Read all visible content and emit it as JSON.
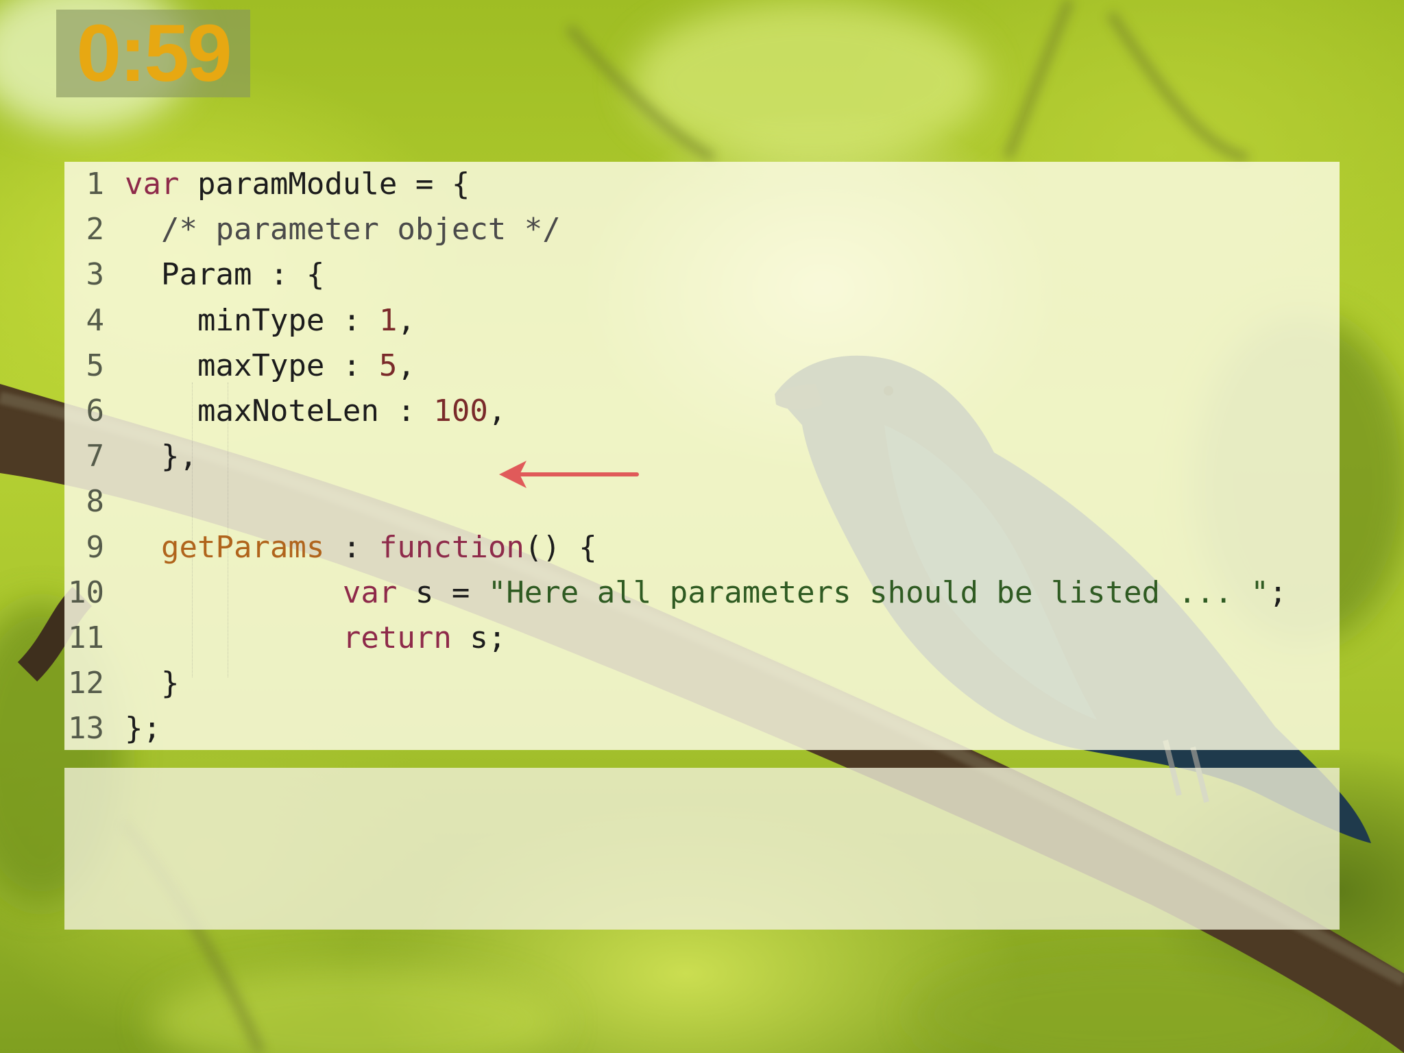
{
  "timer": {
    "text": "0:59",
    "color": "#e7a812"
  },
  "code": {
    "lines": [
      {
        "num": "1",
        "tokens": [
          {
            "t": "var",
            "c": "kw"
          },
          {
            "t": " paramModule = {",
            "c": ""
          }
        ]
      },
      {
        "num": "2",
        "tokens": [
          {
            "t": "  /* parameter object */",
            "c": "cm"
          }
        ]
      },
      {
        "num": "3",
        "tokens": [
          {
            "t": "  Param : {",
            "c": ""
          }
        ]
      },
      {
        "num": "4",
        "tokens": [
          {
            "t": "    minType : ",
            "c": ""
          },
          {
            "t": "1",
            "c": "nm"
          },
          {
            "t": ",",
            "c": ""
          }
        ]
      },
      {
        "num": "5",
        "tokens": [
          {
            "t": "    maxType : ",
            "c": ""
          },
          {
            "t": "5",
            "c": "nm"
          },
          {
            "t": ",",
            "c": ""
          }
        ]
      },
      {
        "num": "6",
        "tokens": [
          {
            "t": "    maxNoteLen : ",
            "c": ""
          },
          {
            "t": "100",
            "c": "nm"
          },
          {
            "t": ",",
            "c": ""
          }
        ]
      },
      {
        "num": "7",
        "tokens": [
          {
            "t": "  },",
            "c": ""
          }
        ]
      },
      {
        "num": "8",
        "tokens": []
      },
      {
        "num": "9",
        "tokens": [
          {
            "t": "  getParams",
            "c": "fn"
          },
          {
            "t": " : ",
            "c": ""
          },
          {
            "t": "function",
            "c": "kw"
          },
          {
            "t": "() {",
            "c": ""
          }
        ]
      },
      {
        "num": "10",
        "tokens": [
          {
            "t": "            ",
            "c": ""
          },
          {
            "t": "var",
            "c": "kw"
          },
          {
            "t": " s = ",
            "c": ""
          },
          {
            "t": "\"Here all parameters should be listed ... \"",
            "c": "st"
          },
          {
            "t": ";",
            "c": ""
          }
        ]
      },
      {
        "num": "11",
        "tokens": [
          {
            "t": "            ",
            "c": ""
          },
          {
            "t": "return",
            "c": "kw"
          },
          {
            "t": " s;",
            "c": ""
          }
        ]
      },
      {
        "num": "12",
        "tokens": [
          {
            "t": "  }",
            "c": ""
          }
        ]
      },
      {
        "num": "13",
        "tokens": [
          {
            "t": "};",
            "c": ""
          }
        ]
      }
    ]
  },
  "annotation": {
    "icon": "left-arrow-icon",
    "color": "#e05a5a"
  },
  "colors": {
    "keyword": "#8e2a4a",
    "number": "#7a2a2a",
    "string": "#2f5b22",
    "function_name": "#b0641c"
  }
}
